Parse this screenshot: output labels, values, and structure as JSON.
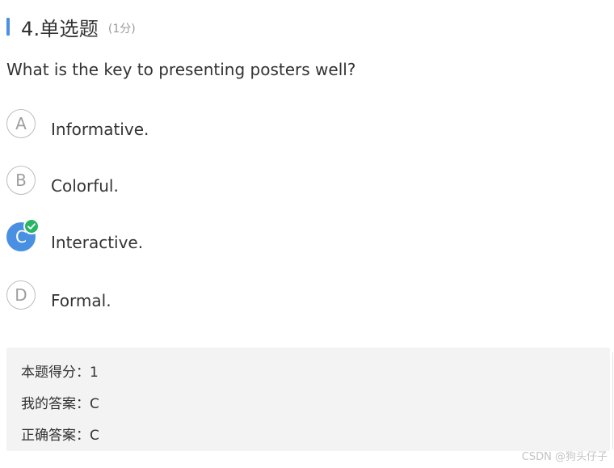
{
  "question": {
    "number_title": "4.单选题",
    "score_note": "(1分)",
    "text": "What is the key to presenting posters well?"
  },
  "options": [
    {
      "letter": "A",
      "text": "Informative.",
      "selected": false
    },
    {
      "letter": "B",
      "text": "Colorful.",
      "selected": false
    },
    {
      "letter": "C",
      "text": "Interactive.",
      "selected": true
    },
    {
      "letter": "D",
      "text": "Formal.",
      "selected": false
    }
  ],
  "result": {
    "score_line": "本题得分：1",
    "my_answer_line": "我的答案：C",
    "correct_answer_line": "正确答案：C"
  },
  "watermark": "CSDN @狗头仔子",
  "colors": {
    "accent": "#4a90e2",
    "check": "#27b665",
    "result_bg": "#f3f3f3"
  },
  "icons": {
    "selected_badge": "check-icon"
  }
}
